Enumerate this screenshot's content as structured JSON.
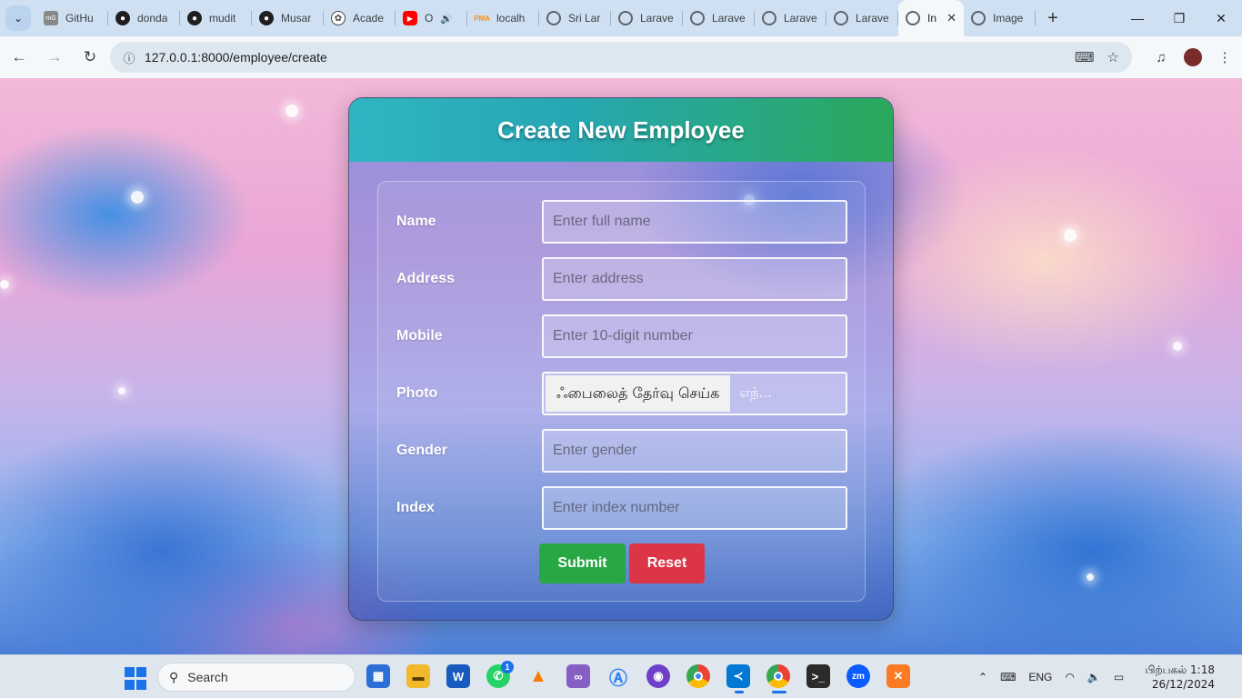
{
  "browser": {
    "tabs": [
      {
        "title": "GitHu",
        "icon": "mg-icon",
        "color": "#555555"
      },
      {
        "title": "donda",
        "icon": "github-icon",
        "color": "#1f1f1f"
      },
      {
        "title": "mudit",
        "icon": "github-icon",
        "color": "#1f1f1f"
      },
      {
        "title": "Musar",
        "icon": "github-icon",
        "color": "#1f1f1f"
      },
      {
        "title": "Acade",
        "icon": "openai-icon",
        "color": "#444444"
      },
      {
        "title": "O",
        "icon": "youtube-icon",
        "color": "#ff0000"
      },
      {
        "title": "localh",
        "icon": "phpmyadmin-icon",
        "color": "#f29111"
      },
      {
        "title": "Sri Lar",
        "icon": "globe-icon",
        "color": "#5f6368"
      },
      {
        "title": "Larave",
        "icon": "globe-icon",
        "color": "#5f6368"
      },
      {
        "title": "Larave",
        "icon": "globe-icon",
        "color": "#5f6368"
      },
      {
        "title": "Larave",
        "icon": "globe-icon",
        "color": "#5f6368"
      },
      {
        "title": "Larave",
        "icon": "globe-icon",
        "color": "#5f6368"
      },
      {
        "title": "In",
        "icon": "globe-icon",
        "color": "#5f6368",
        "active": true
      },
      {
        "title": "Image",
        "icon": "globe-icon",
        "color": "#5f6368"
      }
    ],
    "url": "127.0.0.1:8000/employee/create"
  },
  "page": {
    "title": "Create New Employee",
    "fields": {
      "name": {
        "label": "Name",
        "placeholder": "Enter full name"
      },
      "address": {
        "label": "Address",
        "placeholder": "Enter address"
      },
      "mobile": {
        "label": "Mobile",
        "placeholder": "Enter 10-digit number"
      },
      "photo": {
        "label": "Photo",
        "button": "ஃபைலைத் தேர்வு செய்க",
        "status": "எந்..."
      },
      "gender": {
        "label": "Gender",
        "placeholder": "Enter gender"
      },
      "index": {
        "label": "Index",
        "placeholder": "Enter index number"
      }
    },
    "buttons": {
      "submit": "Submit",
      "reset": "Reset"
    },
    "colors": {
      "header_start": "#2fb5c1",
      "header_end": "#2aa85c",
      "submit": "#28a745",
      "reset": "#dc3545"
    }
  },
  "taskbar": {
    "search_label": "Search",
    "whatsapp_badge": "1",
    "language": "ENG",
    "time": "பிற்பகல் 1:18",
    "date": "26/12/2024"
  }
}
